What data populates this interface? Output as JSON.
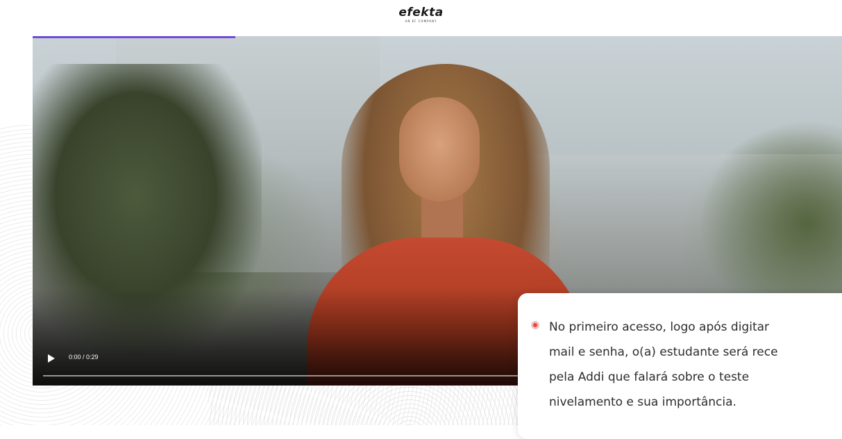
{
  "brand": {
    "logo_text": "efekta",
    "logo_subtext": "AN EF COMPANY"
  },
  "video": {
    "time_display": "0:00 / 0:29",
    "progress_fraction": 0.0,
    "lesson_progress_fraction": 0.25,
    "accent_color": "#6f4bd8"
  },
  "caption": {
    "lines": [
      "No primeiro acesso, logo após digitar",
      "mail e senha, o(a) estudante será rece",
      "pela Addi que falará sobre o teste",
      "nivelamento e sua importância."
    ],
    "bullet_color": "#e64545"
  }
}
